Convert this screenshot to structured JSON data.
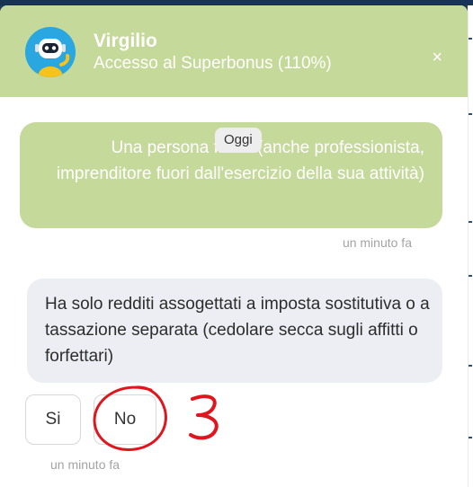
{
  "header": {
    "bot_name": "Virgilio",
    "subtitle": "Accesso al Superbonus (110%)",
    "close_label": "×",
    "color": "#c5d99a"
  },
  "messages": {
    "date_badge": "Oggi",
    "user_message": "Una persona fisica (anche professionista, imprenditore fuori dall'esercizio della sua attività)",
    "user_time": "un minuto fa",
    "bot_message": "Ha solo redditi assogettati a imposta sostitutiva o a tassazione separata (cedolare secca sugli affitti o forfettari)",
    "bot_time": "un minuto fa"
  },
  "quick_replies": [
    "Si",
    "No"
  ],
  "annotation": {
    "label": "3",
    "color": "#e0161e"
  }
}
